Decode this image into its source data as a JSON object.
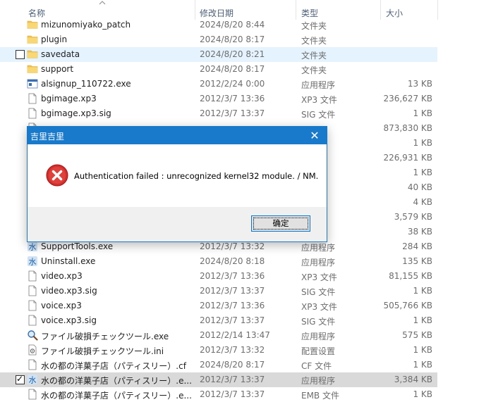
{
  "columns": {
    "name": "名称",
    "date": "修改日期",
    "type": "类型",
    "size": "大小"
  },
  "colors": {
    "folder": "#f2c14e",
    "hover": "#e5f3ff",
    "selected": "#d9d9d9",
    "dialog_title": "#1979ca"
  },
  "rows": [
    {
      "icon": "folder-icon",
      "name": "mizunomiyako_patch",
      "date": "2024/8/20 8:44",
      "type": "文件夹",
      "size": ""
    },
    {
      "icon": "folder-icon",
      "name": "plugin",
      "date": "2024/8/20 8:17",
      "type": "文件夹",
      "size": ""
    },
    {
      "icon": "folder-icon",
      "name": "savedata",
      "date": "2024/8/20 8:21",
      "type": "文件夹",
      "size": ""
    },
    {
      "icon": "folder-icon",
      "name": "support",
      "date": "2024/8/20 8:17",
      "type": "文件夹",
      "size": ""
    },
    {
      "icon": "exe-icon",
      "name": "alsignup_110722.exe",
      "date": "2012/2/24 0:00",
      "type": "应用程序",
      "size": "13 KB"
    },
    {
      "icon": "file-icon",
      "name": "bgimage.xp3",
      "date": "2012/3/7 13:36",
      "type": "XP3 文件",
      "size": "236,627 KB"
    },
    {
      "icon": "file-icon",
      "name": "bgimage.xp3.sig",
      "date": "2012/3/7 13:37",
      "type": "SIG 文件",
      "size": "1 KB"
    },
    {
      "icon": "file-icon",
      "name": "",
      "date": "",
      "type": "",
      "size": "873,830 KB"
    },
    {
      "icon": "file-icon",
      "name": "",
      "date": "",
      "type": "",
      "size": "1 KB"
    },
    {
      "icon": "file-icon",
      "name": "",
      "date": "",
      "type": "",
      "size": "226,931 KB"
    },
    {
      "icon": "file-icon",
      "name": "",
      "date": "",
      "type": "",
      "size": "1 KB"
    },
    {
      "icon": "file-icon",
      "name": "",
      "date": "",
      "type": "",
      "size": "40 KB"
    },
    {
      "icon": "file-icon",
      "name": "",
      "date": "",
      "type": "",
      "size": "4 KB"
    },
    {
      "icon": "file-icon",
      "name": "",
      "date": "",
      "type": "",
      "size": "3,579 KB"
    },
    {
      "icon": "file-icon",
      "name": "",
      "date": "",
      "type": "",
      "size": "38 KB"
    },
    {
      "icon": "app-icon",
      "name": "SupportTools.exe",
      "date": "2012/3/7 13:32",
      "type": "应用程序",
      "size": "284 KB"
    },
    {
      "icon": "app-icon",
      "name": "Uninstall.exe",
      "date": "2024/8/20 8:18",
      "type": "应用程序",
      "size": "135 KB"
    },
    {
      "icon": "file-icon",
      "name": "video.xp3",
      "date": "2012/3/7 13:36",
      "type": "XP3 文件",
      "size": "81,155 KB"
    },
    {
      "icon": "file-icon",
      "name": "video.xp3.sig",
      "date": "2012/3/7 13:37",
      "type": "SIG 文件",
      "size": "1 KB"
    },
    {
      "icon": "file-icon",
      "name": "voice.xp3",
      "date": "2012/3/7 13:36",
      "type": "XP3 文件",
      "size": "505,766 KB"
    },
    {
      "icon": "file-icon",
      "name": "voice.xp3.sig",
      "date": "2012/3/7 13:37",
      "type": "SIG 文件",
      "size": "1 KB"
    },
    {
      "icon": "magnifier-icon",
      "name": "ファイル破損チェックツール.exe",
      "date": "2012/2/14 13:47",
      "type": "应用程序",
      "size": "575 KB"
    },
    {
      "icon": "settings-file-icon",
      "name": "ファイル破損チェックツール.ini",
      "date": "2012/3/7 13:32",
      "type": "配置设置",
      "size": "1 KB"
    },
    {
      "icon": "file-icon",
      "name": "水の都の洋菓子店（パティスリー）.cf",
      "date": "2024/8/20 8:17",
      "type": "CF 文件",
      "size": "1 KB"
    },
    {
      "icon": "app-icon",
      "name": "水の都の洋菓子店（パティスリー）.e...",
      "date": "2012/3/7 13:37",
      "type": "应用程序",
      "size": "3,384 KB"
    },
    {
      "icon": "file-icon",
      "name": "水の都の洋菓子店（パティスリー）.e...",
      "date": "2012/3/7 13:37",
      "type": "EMB 文件",
      "size": "1 KB"
    }
  ],
  "dialog": {
    "title": "吉里吉里",
    "close_glyph": "✕",
    "icon": "error-icon",
    "message": "Authentication failed : unrecognized kernel32 module. / NM.",
    "ok_label": "确定"
  }
}
